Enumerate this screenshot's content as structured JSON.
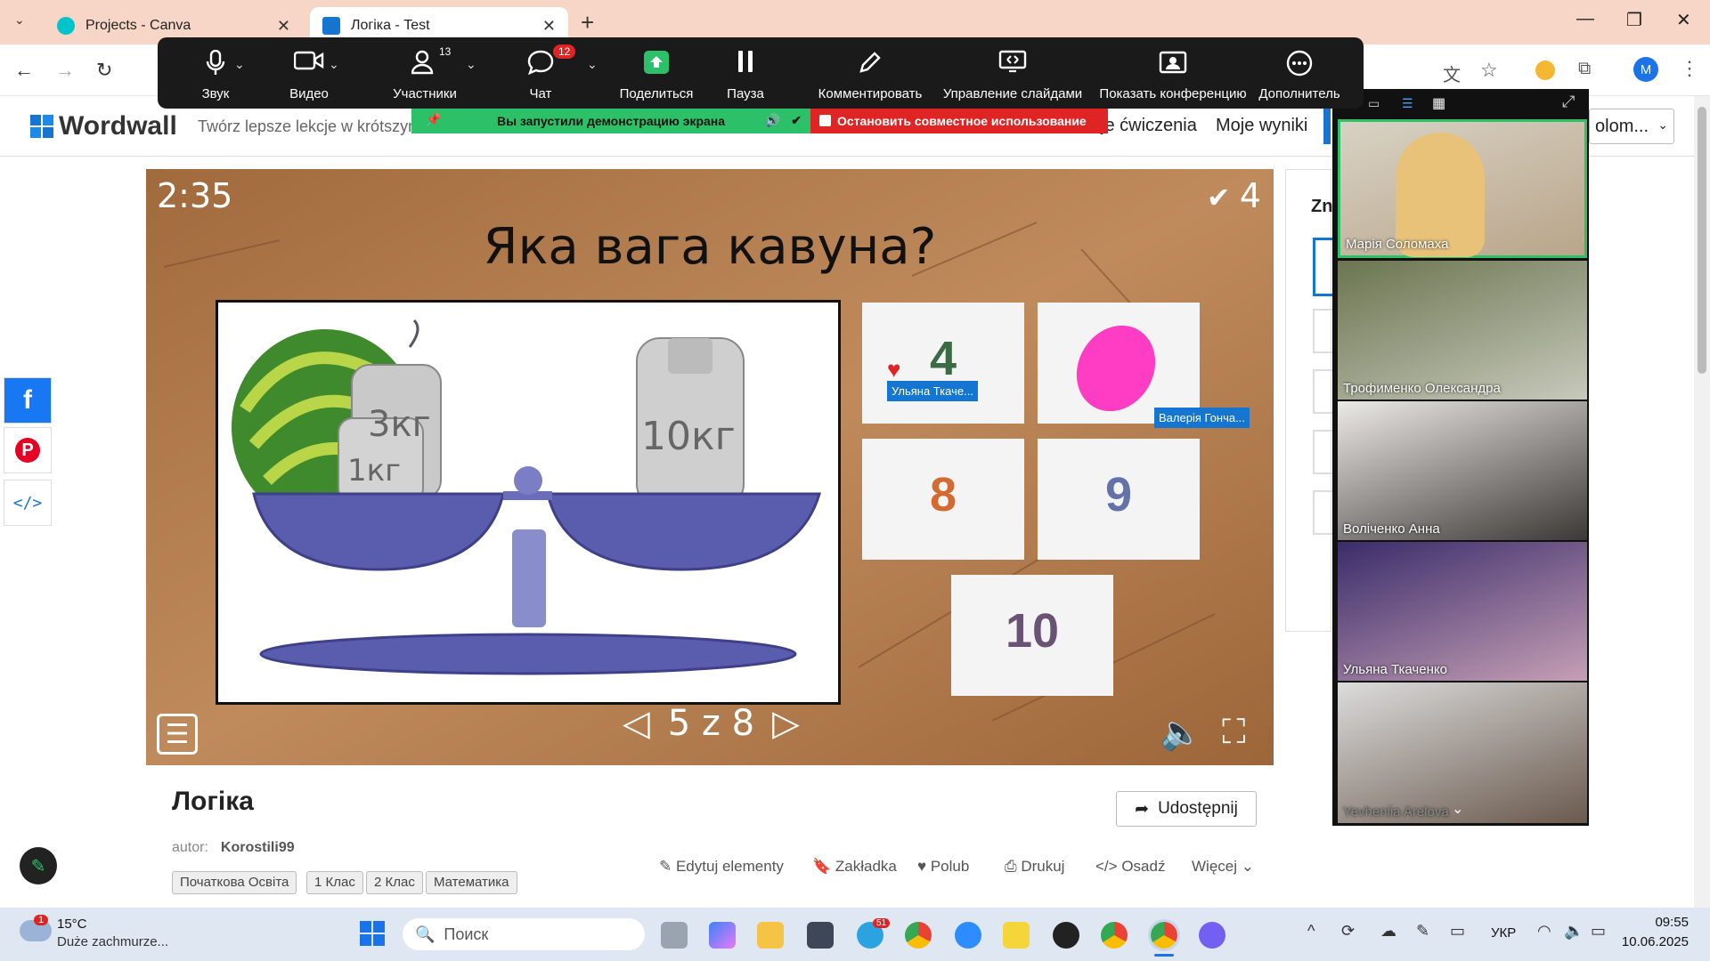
{
  "browser": {
    "tabs": [
      {
        "title": "Projects - Canva",
        "active": false
      },
      {
        "title": "Логіка - Test",
        "active": true
      }
    ],
    "profile_initial": "M"
  },
  "zoom": {
    "toolbar": [
      {
        "icon": "microphone-icon",
        "label": "Звук"
      },
      {
        "icon": "video-camera-icon",
        "label": "Видео"
      },
      {
        "icon": "participants-icon",
        "label": "Участники",
        "badge": "13"
      },
      {
        "icon": "chat-icon",
        "label": "Чат",
        "badge": "12"
      },
      {
        "icon": "share-screen-icon",
        "label": "Поделиться"
      },
      {
        "icon": "pause-icon",
        "label": "Пауза"
      },
      {
        "icon": "annotate-pen-icon",
        "label": "Комментировать"
      },
      {
        "icon": "slides-control-icon",
        "label": "Управление слайдами"
      },
      {
        "icon": "show-conference-icon",
        "label": "Показать конференцию"
      },
      {
        "icon": "more-icon",
        "label": "Дополнитель"
      }
    ],
    "banner_sharing": "Вы запустили демонстрацию экрана",
    "banner_stop": "Остановить совместное использование",
    "participants": [
      {
        "name": "Марія Соломаха",
        "active_speaker": true
      },
      {
        "name": "Трофименко Олександра"
      },
      {
        "name": "Воліченко Анна"
      },
      {
        "name": "Ульяна Ткаченко"
      },
      {
        "name": "Yevheniia Arelova"
      }
    ]
  },
  "wordwall": {
    "logo": "Wordwall",
    "tagline": "Twórz lepsze lekcje w krótszym",
    "nav": [
      "je ćwiczenia",
      "Moje wyniki"
    ],
    "lang_button": "olom...",
    "right_panel_peek": "Zn"
  },
  "game": {
    "timer": "2:35",
    "score": "4",
    "question": "Яка вага кавуна?",
    "weights": [
      "1кг",
      "3кг",
      "10кг"
    ],
    "answers": [
      "4",
      "",
      "8",
      "9",
      "10"
    ],
    "pointer_tags": [
      "Ульяна Ткаче...",
      "Валерія Гонча..."
    ],
    "page": "5 z 8"
  },
  "activity": {
    "title": "Логіка",
    "share_label": "Udostępnij",
    "author_label": "autor:",
    "author_name": "Korostili99",
    "tags": [
      "Початкова Освіта",
      "1 Клас",
      "2 Клас",
      "Математика"
    ],
    "actions": [
      "Edytuj elementy",
      "Zakładka",
      "Polub",
      "Drukuj",
      "Osadź",
      "Więcej"
    ]
  },
  "taskbar": {
    "weather_temp": "15°C",
    "weather_desc": "Duże zachmurze...",
    "weather_badge": "1",
    "search_placeholder": "Поиск",
    "telegram_badge": "51",
    "language": "УКР",
    "time": "09:55",
    "date": "10.06.2025"
  },
  "colors": {
    "zoom_green": "#2cc168",
    "zoom_red": "#e02424",
    "wood": "#b07848",
    "annotation_pink": "#ff3dc4",
    "pointer_blue": "#1476d1"
  }
}
